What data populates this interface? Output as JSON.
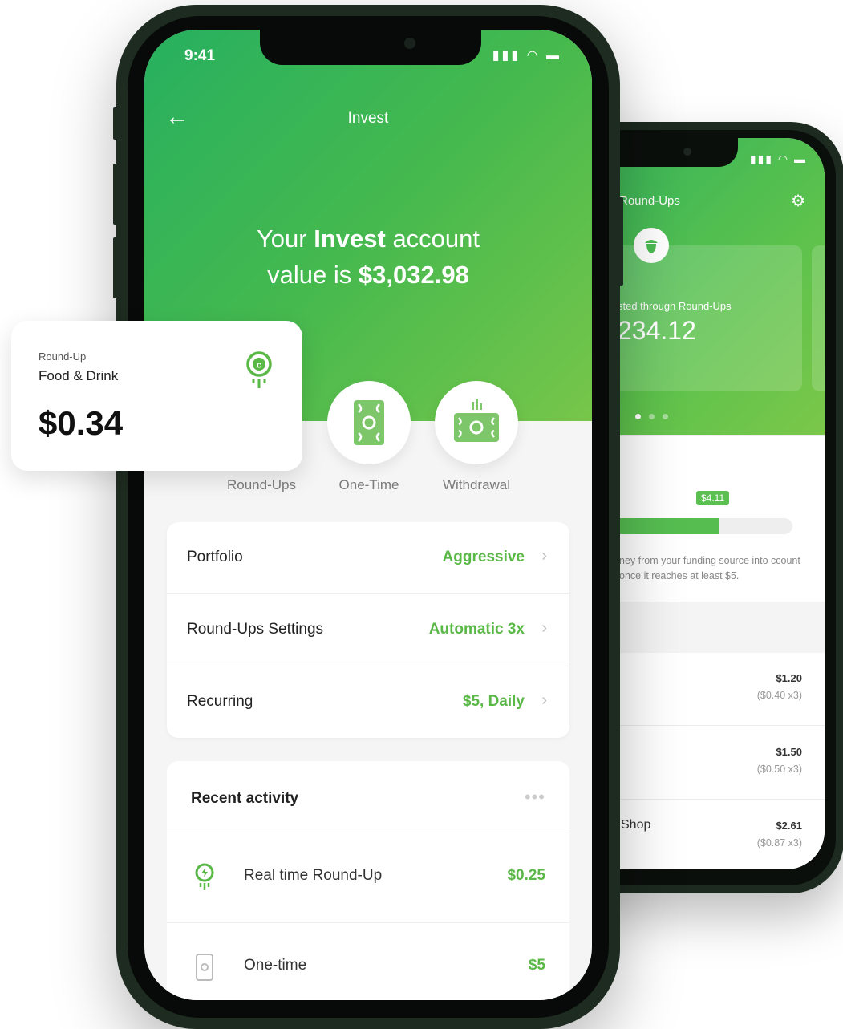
{
  "phone_main": {
    "status": {
      "time": "9:41",
      "icons": "▮▮▮ ◠ ▬"
    },
    "header": {
      "back_icon": "←",
      "title": "Invest"
    },
    "headline": {
      "line1_pre": "Your ",
      "line1_bold": "Invest",
      "line1_post": " account",
      "line2_pre": "value is ",
      "line2_bold": "$3,032.98"
    },
    "actions": [
      {
        "label": "Round-Ups",
        "icon": "roundup-icon"
      },
      {
        "label": "One-Time",
        "icon": "cash-icon"
      },
      {
        "label": "Withdrawal",
        "icon": "withdraw-icon"
      }
    ],
    "settings": [
      {
        "key": "Portfolio",
        "value": "Aggressive"
      },
      {
        "key": "Round-Ups Settings",
        "value": "Automatic 3x"
      },
      {
        "key": "Recurring",
        "value": "$5, Daily"
      }
    ],
    "activity": {
      "title": "Recent activity",
      "more_icon": "•••",
      "items": [
        {
          "name": "Real time Round-Up",
          "amount": "$0.25",
          "icon": "roundup-icon"
        },
        {
          "name": "One-time",
          "amount": "$5",
          "icon": "phone-icon"
        }
      ]
    }
  },
  "roundup_card": {
    "label": "Round-Up",
    "category": "Food & Drink",
    "amount": "$0.34"
  },
  "phone_back": {
    "status_icons": "▮▮▮ ◠ ▬",
    "title": "Round-Ups",
    "gear_icon": "⚙",
    "card_label": "sted through Round-Ups",
    "card_amount": "234.12",
    "bubble": "$4.11",
    "progress_fraction": 0.58,
    "note": "ney from your funding source into ccount once it reaches at least $5.",
    "rows": [
      {
        "name": "",
        "amount": "$1.20",
        "sub": "($0.40 x3)"
      },
      {
        "name": "",
        "amount": "$1.50",
        "sub": "($0.50 x3)"
      },
      {
        "name": "Shop",
        "amount": "$2.61",
        "sub": "($0.87 x3)"
      }
    ]
  },
  "colors": {
    "accent": "#5ab847",
    "header_start": "#27b060",
    "header_end": "#77c64a"
  }
}
